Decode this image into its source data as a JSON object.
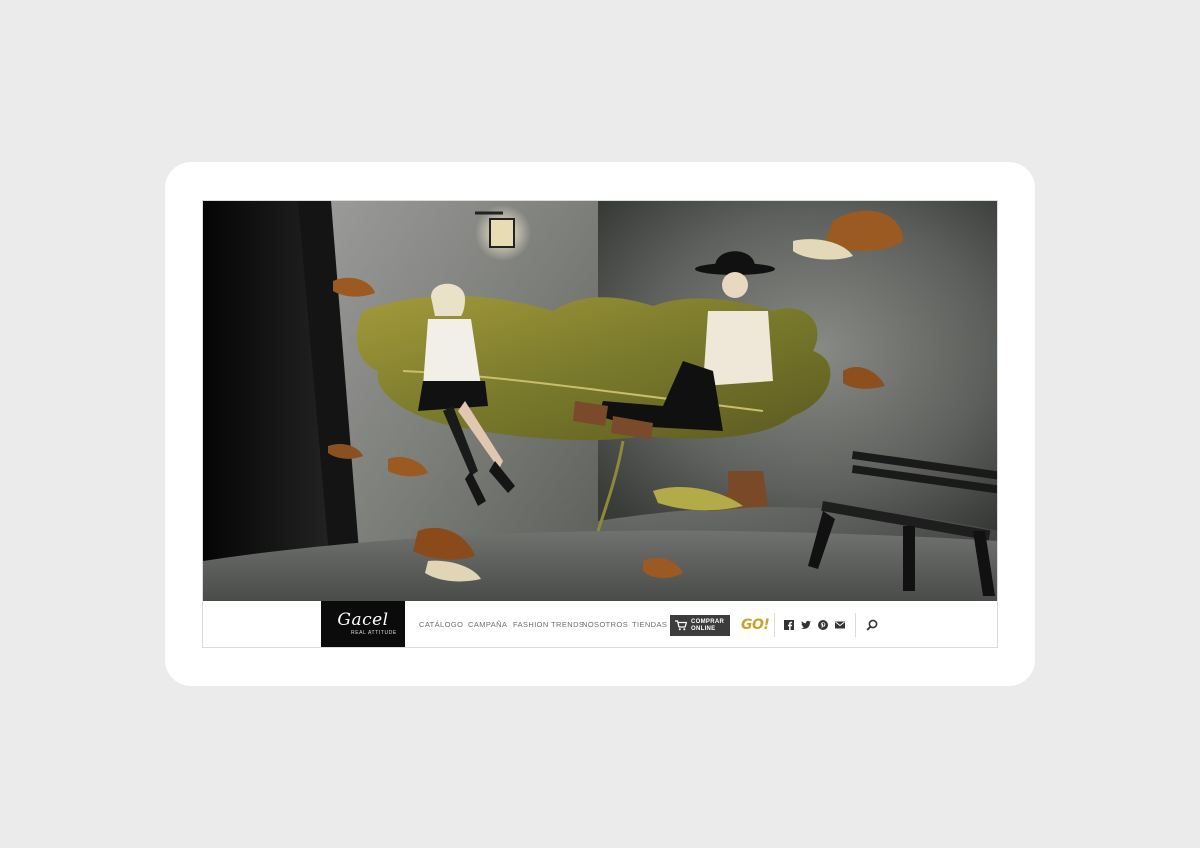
{
  "brand": {
    "name": "Gacel",
    "tagline": "REAL ATTITUDE"
  },
  "nav": {
    "items": [
      {
        "label": "CATÁLOGO"
      },
      {
        "label": "CAMPAÑA"
      },
      {
        "label": "FASHION TRENDS"
      },
      {
        "label": "NOSOTROS"
      },
      {
        "label": "TIENDAS"
      }
    ],
    "shop_button": {
      "line1": "COMPRAR",
      "line2": "ONLINE",
      "icon": "cart-icon"
    },
    "go_logo": "GO!",
    "social": [
      "facebook-icon",
      "twitter-icon",
      "pinterest-icon",
      "mail-icon"
    ],
    "search_icon": "search-icon"
  },
  "colors": {
    "nav_text": "#6e6e6e",
    "logo_bg": "#0b0b0b",
    "shop_bg": "#3c3c3c",
    "go_accent": "#c9a22a"
  }
}
